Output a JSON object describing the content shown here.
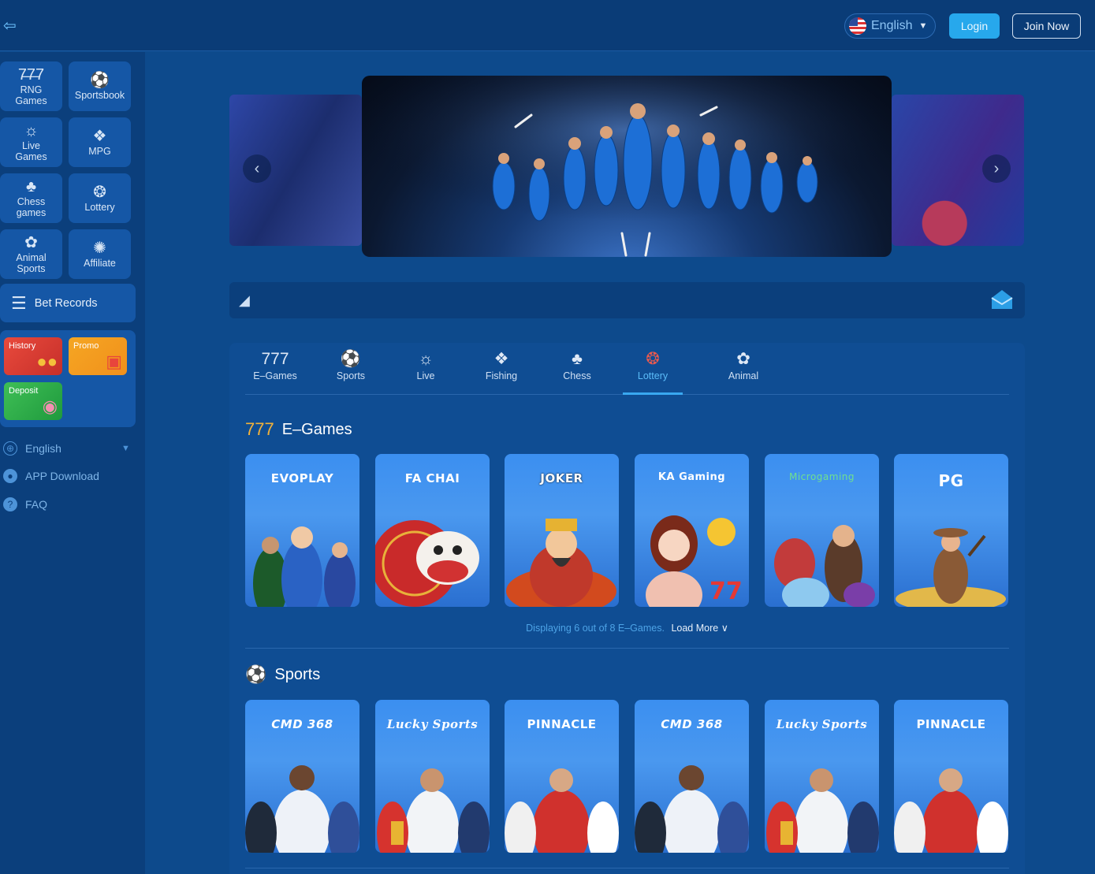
{
  "header": {
    "language": "English",
    "login": "Login",
    "join": "Join Now"
  },
  "sidebar": {
    "categories": [
      {
        "label": "RNG\nGames",
        "icon": "slot-777-icon"
      },
      {
        "label": "Sportsbook",
        "icon": "soccer-ball-icon"
      },
      {
        "label": "Live\nGames",
        "icon": "dealer-icon"
      },
      {
        "label": "MPG",
        "icon": "fish-icon"
      },
      {
        "label": "Chess\ngames",
        "icon": "cards-icon"
      },
      {
        "label": "Lottery",
        "icon": "lottery-balls-icon"
      },
      {
        "label": "Animal\nSports",
        "icon": "rooster-icon"
      },
      {
        "label": "Affiliate",
        "icon": "network-icon"
      }
    ],
    "bet_records": "Bet Records",
    "promos": {
      "history": "History",
      "promo": "Promo",
      "deposit": "Deposit"
    },
    "links": {
      "language": "English",
      "app_download": "APP Download",
      "faq": "FAQ"
    }
  },
  "tabs": [
    {
      "label": "E–Games",
      "icon": "slot-777-icon"
    },
    {
      "label": "Sports",
      "icon": "soccer-ball-icon"
    },
    {
      "label": "Live",
      "icon": "dealer-icon"
    },
    {
      "label": "Fishing",
      "icon": "fish-icon"
    },
    {
      "label": "Chess",
      "icon": "cards-icon"
    },
    {
      "label": "Lottery",
      "icon": "lottery-balls-icon",
      "active": true
    },
    {
      "label": "Animal",
      "icon": "rooster-icon"
    }
  ],
  "egames": {
    "title": "E–Games",
    "providers": [
      "EVOPLAY",
      "FA CHAI",
      "JOKER",
      "KA Gaming",
      "Microgaming",
      "PG"
    ],
    "displaying": "Displaying 6 out of 8 E–Games.",
    "load_more": "Load More"
  },
  "sports": {
    "title": "Sports",
    "providers": [
      "CMD 368",
      "Lucky Sports",
      "PINNACLE",
      "CMD 368",
      "Lucky Sports",
      "PINNACLE"
    ]
  },
  "colors": {
    "background": "#0d4a8c",
    "header": "#0a3c77",
    "accent": "#27a8ec",
    "active_tab": "#5bbcf8"
  }
}
